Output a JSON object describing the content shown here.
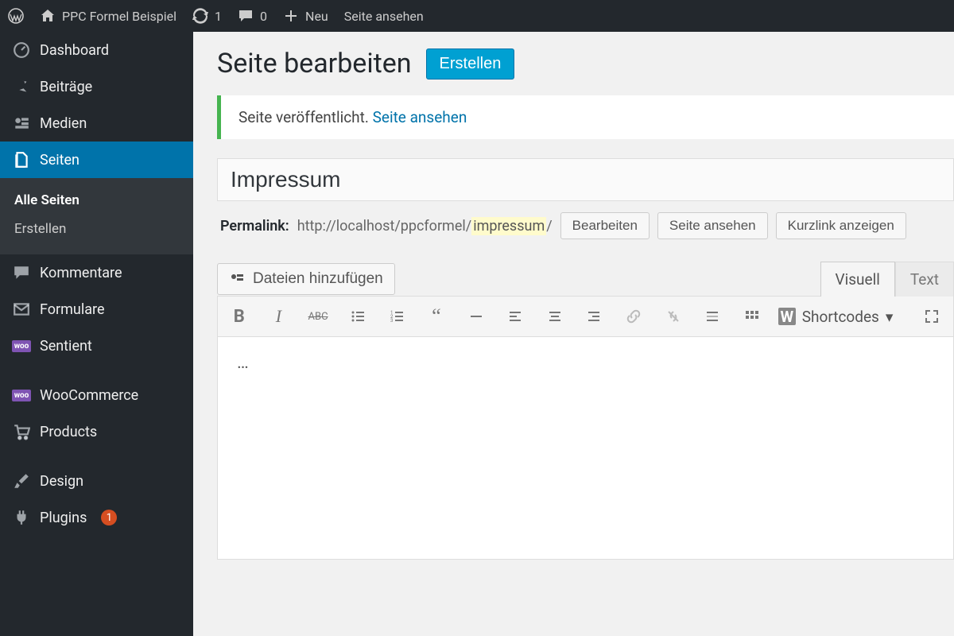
{
  "adminbar": {
    "site_name": "PPC Formel Beispiel",
    "updates_count": "1",
    "comments_count": "0",
    "new_label": "Neu",
    "view_site_label": "Seite ansehen"
  },
  "sidebar": {
    "dashboard": "Dashboard",
    "posts": "Beiträge",
    "media": "Medien",
    "pages": "Seiten",
    "pages_sub_all": "Alle Seiten",
    "pages_sub_new": "Erstellen",
    "comments": "Kommentare",
    "forms": "Formulare",
    "sentient": "Sentient",
    "woocommerce": "WooCommerce",
    "products": "Products",
    "design": "Design",
    "plugins": "Plugins",
    "plugins_count": "1"
  },
  "heading": {
    "title": "Seite bearbeiten",
    "create_btn": "Erstellen"
  },
  "notice": {
    "text": "Seite veröffentlicht. ",
    "link": "Seite ansehen"
  },
  "editor": {
    "title_value": "Impressum",
    "permalink_label": "Permalink:",
    "permalink_base": "http://localhost/ppcformel/",
    "permalink_slug": "impressum",
    "permalink_trail": "/",
    "edit_btn": "Bearbeiten",
    "view_btn": "Seite ansehen",
    "shortlink_btn": "Kurzlink anzeigen",
    "add_media": "Dateien hinzufügen",
    "tab_visual": "Visuell",
    "tab_text": "Text",
    "shortcodes": "Shortcodes",
    "body": "…"
  }
}
